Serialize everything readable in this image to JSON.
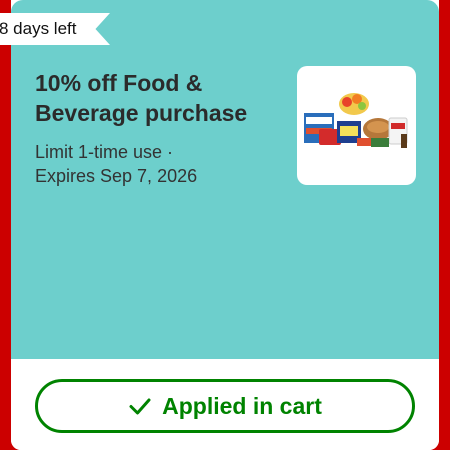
{
  "badge": {
    "text": "8 days left"
  },
  "offer": {
    "title_line1": "10% off Food &",
    "title_line2": "Beverage purchase",
    "limit_line": "Limit 1-time use ·",
    "expires_line": "Expires Sep 7, 2026",
    "image_icon": "food-products-image"
  },
  "action": {
    "label": "Applied in cart",
    "icon": "checkmark-icon"
  },
  "colors": {
    "panel": "#6dcfcc",
    "success": "#008300",
    "frame": "#cc0000"
  }
}
